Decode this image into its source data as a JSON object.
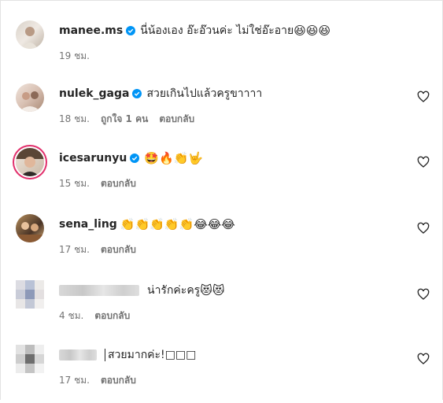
{
  "comments": [
    {
      "username": "manee.ms",
      "verified": true,
      "text": "นี่น้องเอง อ๊ะอ๊วนค่ะ ไม่ใช่อ๊ะอาย",
      "emojis": "😆😆😆",
      "time": "19 ชม.",
      "likes": "",
      "reply": ""
    },
    {
      "username": "nulek_gaga",
      "verified": true,
      "text": "สวยเกินไปแล้วครูขาาาา",
      "emojis": "",
      "time": "18 ชม.",
      "likes": "ถูกใจ 1 คน",
      "reply": "ตอบกลับ"
    },
    {
      "username": "icesarunyu",
      "verified": true,
      "text": "",
      "emojis": "🤩🔥👏🤟",
      "time": "15 ชม.",
      "likes": "",
      "reply": "ตอบกลับ"
    },
    {
      "username": "sena_ling",
      "verified": false,
      "text": "",
      "emojis": "👏👏👏👏👏😂😂😂",
      "time": "17 ชม.",
      "likes": "",
      "reply": "ตอบกลับ"
    },
    {
      "username": "",
      "verified": false,
      "text": "น่ารักค่ะครู",
      "emojis": "😻😻",
      "time": "4 ชม.",
      "likes": "",
      "reply": "ตอบกลับ"
    },
    {
      "username": "",
      "verified": false,
      "text": "สวยมากค่ะ!",
      "emojis": "□□□",
      "time": "17 ชม.",
      "likes": "",
      "reply": "ตอบกลับ"
    }
  ],
  "icons": {
    "verified": "verified-badge-icon",
    "like": "heart-outline-icon"
  },
  "colors": {
    "verified": "#0095f6",
    "meta": "#737373",
    "story_ring": "#e1306c"
  }
}
